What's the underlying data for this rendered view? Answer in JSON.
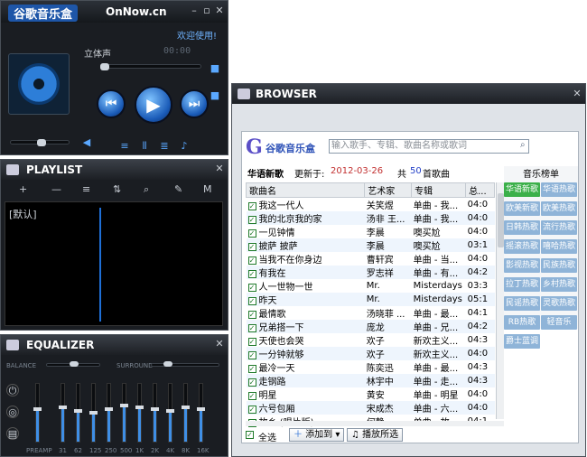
{
  "player": {
    "app_title": "谷歌音乐盒",
    "site": "OnNow.cn",
    "welcome": "欢迎使用!",
    "stereo": "立体声",
    "time_display": "00:00"
  },
  "playlist": {
    "title": "PLAYLIST",
    "default_list": "[默认]"
  },
  "equalizer": {
    "title": "EQUALIZER",
    "balance_label": "BALANCE",
    "surround_label": "SURROUND",
    "preamp_label": "PREAMP",
    "bands": [
      "31",
      "62",
      "125",
      "250",
      "500",
      "1K",
      "2K",
      "4K",
      "8K",
      "16K"
    ]
  },
  "browser": {
    "title": "BROWSER",
    "logo_text": "谷歌音乐盒",
    "search_placeholder": "输入歌手、专辑、歌曲名称或歌词",
    "section_title": "华语新歌",
    "updated_label": "更新于:",
    "updated_date": "2012-03-26",
    "count_prefix": "共",
    "count_value": "50",
    "count_suffix": "首歌曲",
    "columns": [
      "歌曲名",
      "艺术家",
      "专辑",
      "总..."
    ],
    "songs": [
      {
        "name": "我这一代人",
        "artist": "关笑煜",
        "album": "单曲 - 我...",
        "dur": "04:0"
      },
      {
        "name": "我的北京我的家",
        "artist": "汤非 王...",
        "album": "单曲 - 我...",
        "dur": "04:0"
      },
      {
        "name": "一见钟情",
        "artist": "李晨",
        "album": "噢买尬",
        "dur": "04:0"
      },
      {
        "name": "披萨 披萨",
        "artist": "李晨",
        "album": "噢买尬",
        "dur": "03:1"
      },
      {
        "name": "当我不在你身边",
        "artist": "曹轩宾",
        "album": "单曲 - 当...",
        "dur": "04:0"
      },
      {
        "name": "有我在",
        "artist": "罗志祥",
        "album": "单曲 - 有...",
        "dur": "04:2"
      },
      {
        "name": "人一世物一世",
        "artist": "Mr.",
        "album": "Misterdays",
        "dur": "03:3"
      },
      {
        "name": "昨天",
        "artist": "Mr.",
        "album": "Misterdays",
        "dur": "05:1"
      },
      {
        "name": "最情歌",
        "artist": "汤晓菲 ...",
        "album": "单曲 - 最...",
        "dur": "04:1"
      },
      {
        "name": "兄弟搭一下",
        "artist": "庞龙",
        "album": "单曲 - 兄...",
        "dur": "04:2"
      },
      {
        "name": "天使也会哭",
        "artist": "欢子",
        "album": "新欢主义...",
        "dur": "04:3"
      },
      {
        "name": "一分钟就够",
        "artist": "欢子",
        "album": "新欢主义...",
        "dur": "04:0"
      },
      {
        "name": "最冷一天",
        "artist": "陈奕迅",
        "album": "单曲 - 最...",
        "dur": "04:3"
      },
      {
        "name": "走钢路",
        "artist": "林宇中",
        "album": "单曲 - 走...",
        "dur": "04:3"
      },
      {
        "name": "明星",
        "artist": "黄安",
        "album": "单曲 - 明星",
        "dur": "04:0"
      },
      {
        "name": "六号包厢",
        "artist": "宋成杰",
        "album": "单曲 - 六...",
        "dur": "04:0"
      },
      {
        "name": "故乡 (唱片版)",
        "artist": "何静",
        "album": "单曲 - 故...",
        "dur": "04:1"
      }
    ],
    "select_all": "全选",
    "add_to": "添加到",
    "play_selected": "播放所选",
    "charts_title": "音乐榜单",
    "charts": [
      "华语新歌",
      "华语热歌",
      "欧美新歌",
      "欧美热歌",
      "日韩热歌",
      "流行热歌",
      "摇滚热歌",
      "嘻哈热歌",
      "影视热歌",
      "民族热歌",
      "拉丁热歌",
      "乡村热歌",
      "民谣热歌",
      "灵歌热歌",
      "RB热歌",
      "轻音乐",
      "爵士蓝调"
    ],
    "colors": {
      "active_chip": "#3bb04a",
      "chip": "#8fb4d8",
      "date": "#c23030",
      "count": "#2340c8"
    }
  }
}
